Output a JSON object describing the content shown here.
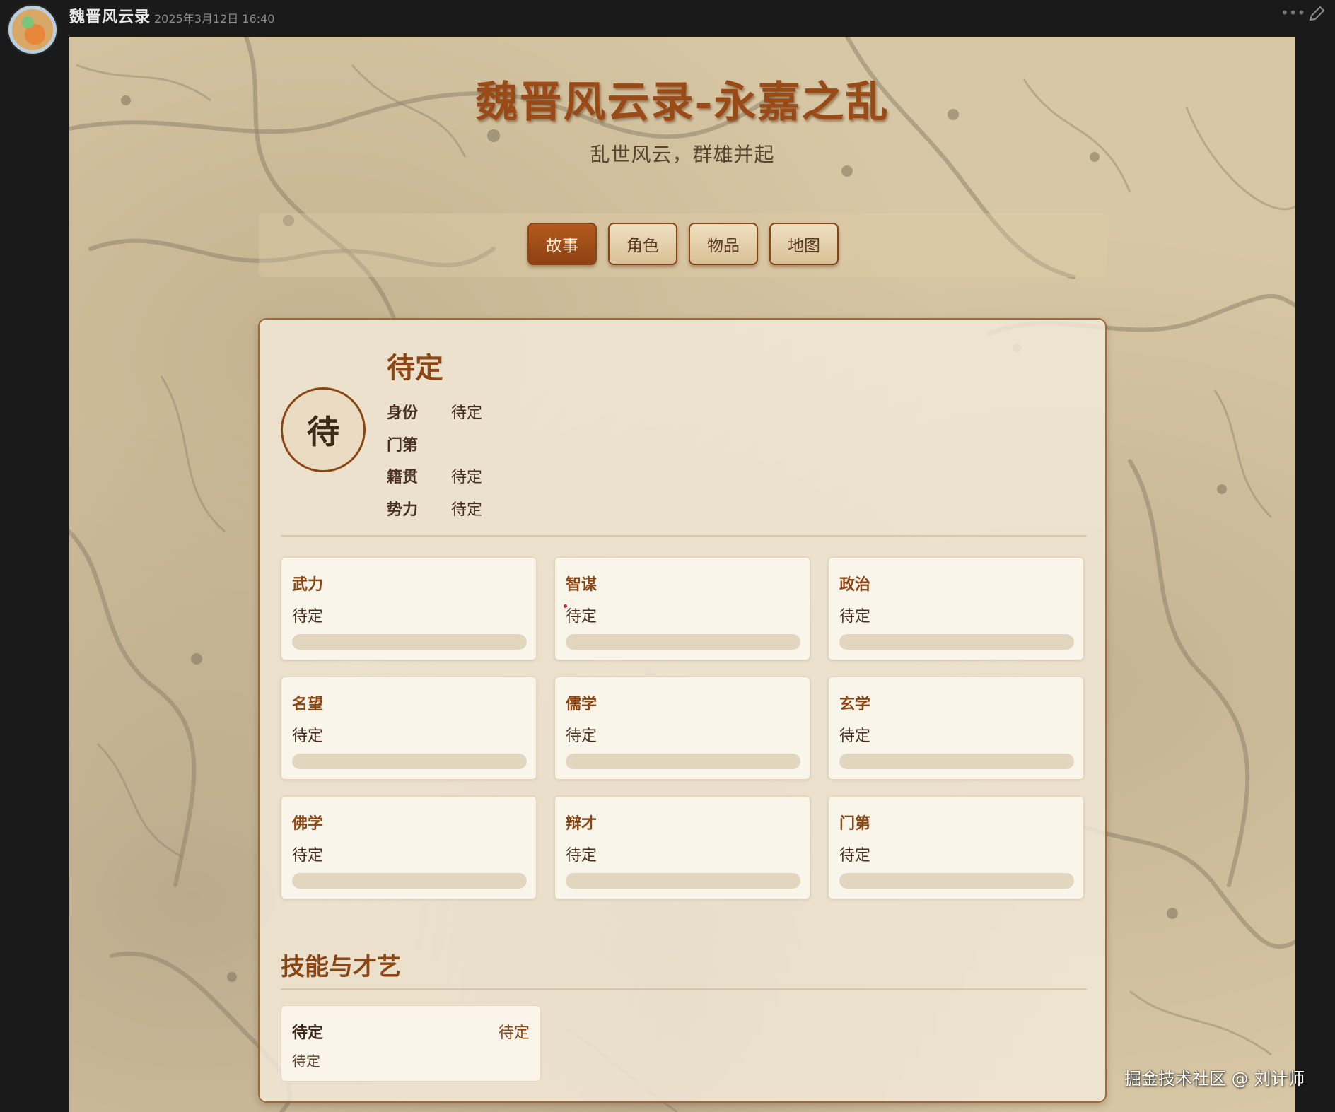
{
  "chat": {
    "sender": "魏晋风云录",
    "timestamp": "2025年3月12日 16:40",
    "more_icon": "ellipsis-icon",
    "edit_icon": "pencil-icon"
  },
  "app": {
    "title": "魏晋风云录-永嘉之乱",
    "subtitle": "乱世风云，群雄并起",
    "nav": [
      {
        "label": "故事",
        "active": true
      },
      {
        "label": "角色",
        "active": false
      },
      {
        "label": "物品",
        "active": false
      },
      {
        "label": "地图",
        "active": false
      }
    ]
  },
  "character": {
    "portrait_char": "待",
    "name": "待定",
    "info": [
      {
        "label": "身份",
        "value": "待定"
      },
      {
        "label": "门第",
        "value": ""
      },
      {
        "label": "籍贯",
        "value": "待定"
      },
      {
        "label": "势力",
        "value": "待定"
      }
    ],
    "stats": [
      {
        "label": "武力",
        "value": "待定"
      },
      {
        "label": "智谋",
        "value": "待定"
      },
      {
        "label": "政治",
        "value": "待定"
      },
      {
        "label": "名望",
        "value": "待定"
      },
      {
        "label": "儒学",
        "value": "待定"
      },
      {
        "label": "玄学",
        "value": "待定"
      },
      {
        "label": "佛学",
        "value": "待定"
      },
      {
        "label": "辩才",
        "value": "待定"
      },
      {
        "label": "门第",
        "value": "待定"
      }
    ],
    "stat_fill_fraction": 0
  },
  "skills": {
    "heading": "技能与才艺",
    "items": [
      {
        "name": "待定",
        "level": "待定",
        "desc": "待定"
      }
    ]
  },
  "watermark": "掘金技术社区 @ 刘计师",
  "colors": {
    "accent": "#8b4513",
    "parchment": "#d8c7a4",
    "active_button": "#a8521b"
  }
}
